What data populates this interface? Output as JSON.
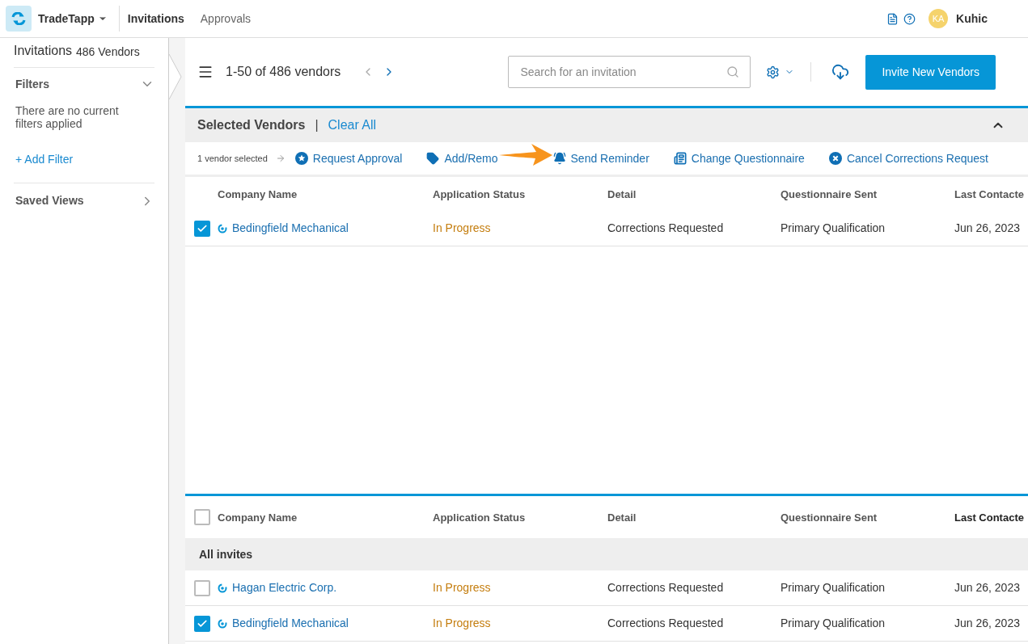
{
  "header": {
    "app_name": "TradeTapp",
    "nav": [
      {
        "label": "Invitations",
        "selected": true
      },
      {
        "label": "Approvals",
        "selected": false
      }
    ],
    "user": {
      "initials": "KA",
      "name": "Kuhic"
    }
  },
  "sidebar": {
    "title": "Invitations",
    "count": "486 Vendors",
    "filters_label": "Filters",
    "empty_text": "There are no current filters applied",
    "add_filter": "+ Add Filter",
    "saved_views": "Saved Views"
  },
  "toolbar": {
    "range": "1-50 of 486 vendors",
    "search_placeholder": "Search for an invitation",
    "invite_button": "Invite New Vendors"
  },
  "selected_panel": {
    "title": "Selected Vendors",
    "separator": "|",
    "clear_all": "Clear All",
    "selection_count": "1 vendor selected",
    "actions": [
      {
        "kind": "approval",
        "label": "Request Approval"
      },
      {
        "kind": "tag",
        "label": "Add/Remo"
      },
      {
        "kind": "reminder",
        "label": "Send Reminder"
      },
      {
        "kind": "questionnaire",
        "label": "Change Questionnaire"
      },
      {
        "kind": "cancel",
        "label": "Cancel Corrections Request"
      }
    ],
    "columns": [
      "Company Name",
      "Application Status",
      "Detail",
      "Questionnaire Sent",
      "Last Contacte"
    ],
    "rows": [
      {
        "checked": true,
        "company": "Bedingfield Mechanical",
        "status": "In Progress",
        "detail": "Corrections Requested",
        "questionnaire": "Primary Qualification",
        "last_contacted": "Jun 26, 2023"
      }
    ]
  },
  "all_table": {
    "select_all_checked": false,
    "columns": [
      "Company Name",
      "Application Status",
      "Detail",
      "Questionnaire Sent",
      "Last Contacte"
    ],
    "group": "All invites",
    "rows": [
      {
        "checked": false,
        "company": "Hagan Electric Corp.",
        "status": "In Progress",
        "detail": "Corrections Requested",
        "questionnaire": "Primary Qualification",
        "last_contacted": "Jun 26, 2023"
      },
      {
        "checked": true,
        "company": "Bedingfield Mechanical",
        "status": "In Progress",
        "detail": "Corrections Requested",
        "questionnaire": "Primary Qualification",
        "last_contacted": "Jun 26, 2023"
      }
    ]
  }
}
